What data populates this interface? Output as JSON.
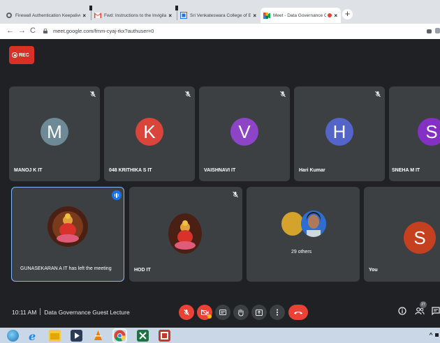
{
  "browser": {
    "tabs": [
      {
        "title": "Firewall Authentication Keepalive",
        "favicon": "globe-icon",
        "active": false
      },
      {
        "title": "Fwd: Instructions to the Invigilator",
        "favicon": "gmail-icon",
        "active": false
      },
      {
        "title": "Sri Venkateswara College of Engi",
        "favicon": "college-icon",
        "active": false
      },
      {
        "title": "Meet - Data Governance Gu",
        "favicon": "meet-icon",
        "active": true,
        "recording": true
      }
    ],
    "close_glyph": "×",
    "new_tab_glyph": "+",
    "url": "meet.google.com/fmm-cyaj-rkx?authuser=0",
    "nav": {
      "back": "←",
      "forward": "→",
      "reload": "C"
    }
  },
  "meeting": {
    "rec_label": "REC",
    "time": "10:11 AM",
    "title": "Data Governance Guest Lecture",
    "participant_count": "27",
    "tiles": [
      {
        "name": "MANOJ K IT",
        "initial": "M",
        "color": "#6e8a97",
        "muted": true
      },
      {
        "name": "048 KRITHIKA S IT",
        "initial": "K",
        "color": "#d9443b",
        "muted": true
      },
      {
        "name": "VAISHNAVI IT",
        "initial": "V",
        "color": "#8d44c7",
        "muted": true
      },
      {
        "name": "Hari Kumar",
        "initial": "H",
        "color": "#5365c9",
        "muted": true
      },
      {
        "name": "SNEHA M IT",
        "initial": "S",
        "color": "#8430c4",
        "muted": false
      },
      {
        "name": "GUNASEKARAN A IT has left the meeting",
        "speaking": true
      },
      {
        "name": "HOD IT",
        "muted": true
      },
      {
        "name": "29 others"
      },
      {
        "name": "You",
        "initial": "S",
        "color": "#c5401f"
      }
    ]
  },
  "colors": {
    "accent": "#1a73e8",
    "danger": "#ea4335",
    "tile": "#3c4043",
    "bg": "#202124"
  }
}
